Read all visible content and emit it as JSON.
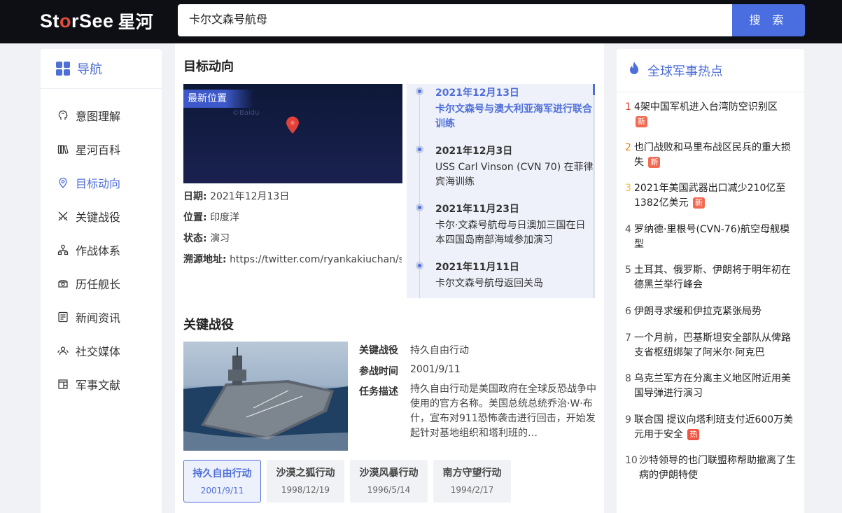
{
  "header": {
    "logo_text_a": "St",
    "logo_text_o": "o",
    "logo_text_b": "rSee",
    "logo_cn": "星河",
    "search_value": "卡尔文森号航母",
    "search_button": "搜 索"
  },
  "sidebar": {
    "title": "导航",
    "items": [
      {
        "label": "意图理解",
        "icon": "brain-head-icon"
      },
      {
        "label": "星河百科",
        "icon": "books-icon"
      },
      {
        "label": "目标动向",
        "icon": "location-pin-icon",
        "active": true
      },
      {
        "label": "关键战役",
        "icon": "crossed-swords-icon"
      },
      {
        "label": "作战体系",
        "icon": "hierarchy-icon"
      },
      {
        "label": "历任舰长",
        "icon": "captain-icon"
      },
      {
        "label": "新闻资讯",
        "icon": "news-icon"
      },
      {
        "label": "社交媒体",
        "icon": "social-people-icon"
      },
      {
        "label": "军事文献",
        "icon": "document-icon"
      }
    ]
  },
  "target": {
    "title": "目标动向",
    "map_tag": "最新位置",
    "map_watermark": "©Baidu",
    "date_label": "日期:",
    "date_value": "2021年12月13日",
    "location_label": "位置:",
    "location_value": "印度洋",
    "status_label": "状态:",
    "status_value": "演习",
    "source_label": "溯源地址:",
    "source_value": "https://twitter.com/ryankakiuchan/s...",
    "timeline": [
      {
        "date": "2021年12月13日",
        "text": "卡尔文森号与澳大利亚海军进行联合训练"
      },
      {
        "date": "2021年12月3日",
        "text": "USS Carl Vinson (CVN 70) 在菲律宾海训练"
      },
      {
        "date": "2021年11月23日",
        "text": "卡尔·文森号航母与日澳加三国在日本四国岛南部海域参加演习"
      },
      {
        "date": "2021年11月11日",
        "text": "卡尔文森号航母返回关岛"
      }
    ]
  },
  "battle": {
    "title": "关键战役",
    "name_label": "关键战役",
    "name_value": "持久自由行动",
    "time_label": "参战时间",
    "time_value": "2001/9/11",
    "desc_label": "任务描述",
    "desc_value": "持久自由行动是美国政府在全球反恐战争中使用的官方名称。美国总统总统乔治·W·布什，宣布对911恐怖袭击进行回击，开始发起针对基地组织和塔利班的…",
    "ops": [
      {
        "name": "持久自由行动",
        "date": "2001/9/11",
        "active": true
      },
      {
        "name": "沙漠之狐行动",
        "date": "1998/12/19"
      },
      {
        "name": "沙漠风暴行动",
        "date": "1996/5/14"
      },
      {
        "name": "南方守望行动",
        "date": "1994/2/17"
      }
    ]
  },
  "hot": {
    "title": "全球军事热点",
    "new_badge": "新",
    "hot_badge": "热",
    "items": [
      {
        "num": "1",
        "text": "4架中国军机进入台湾防空识别区",
        "badge": "新"
      },
      {
        "num": "2",
        "text": "也门战败和马里布战区民兵的重大损失",
        "badge": "新"
      },
      {
        "num": "3",
        "text": "2021年美国武器出口减少210亿至1382亿美元",
        "badge": "新"
      },
      {
        "num": "4",
        "text": "罗纳德·里根号(CVN-76)航空母舰模型"
      },
      {
        "num": "5",
        "text": "土耳其、俄罗斯、伊朗将于明年初在德黑兰举行峰会"
      },
      {
        "num": "6",
        "text": "伊朗寻求缓和伊拉克紧张局势"
      },
      {
        "num": "7",
        "text": "一个月前，巴基斯坦安全部队从俾路支省枢纽绑架了阿米尔·阿克巴"
      },
      {
        "num": "8",
        "text": "乌克兰军方在分离主义地区附近用美国导弹进行演习"
      },
      {
        "num": "9",
        "text": "联合国 提议向塔利班支付近600万美元用于安全",
        "badge": "热"
      },
      {
        "num": "10",
        "text": "沙特领导的也门联盟称帮助撤离了生病的伊朗特使"
      }
    ]
  },
  "colors": {
    "accent": "#4f6fd8",
    "header_bg": "#0e0f14",
    "search_button": "#4a6ee0",
    "badge": "#f26a52"
  }
}
